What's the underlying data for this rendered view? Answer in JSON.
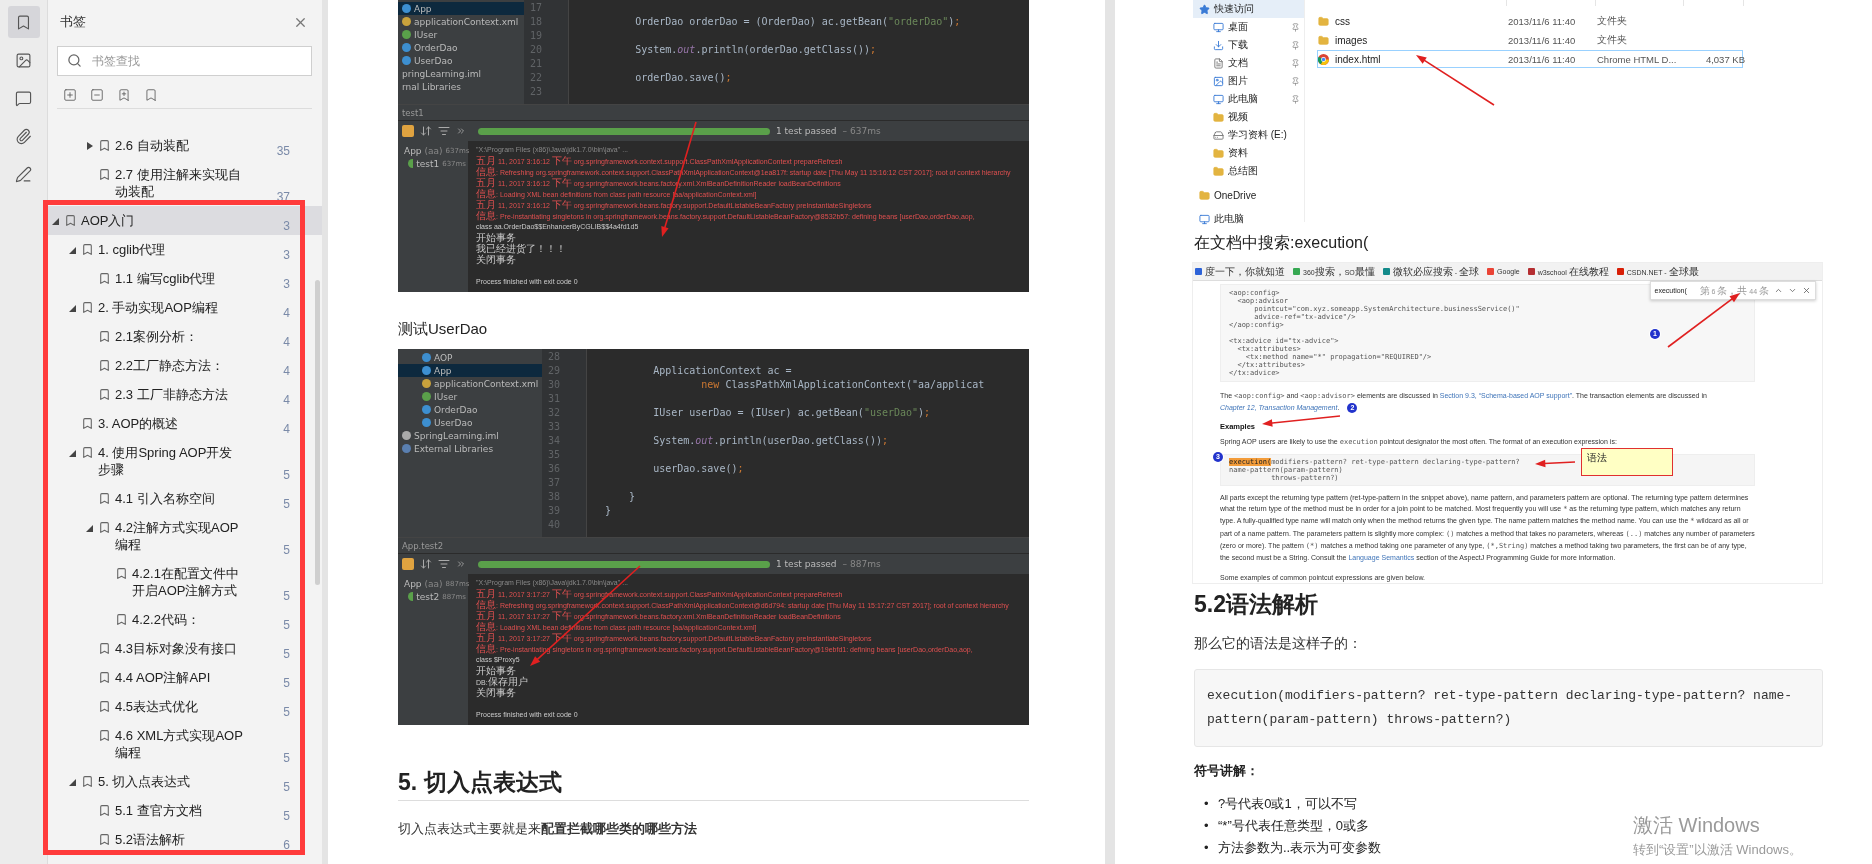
{
  "rail": [
    {
      "kind": "bookmarks",
      "selected": true
    },
    {
      "kind": "images",
      "selected": false
    },
    {
      "kind": "comments",
      "selected": false
    },
    {
      "kind": "attachments",
      "selected": false
    },
    {
      "kind": "signature",
      "selected": false
    }
  ],
  "sidebar": {
    "title": "书签",
    "search": {
      "placeholder": "书签查找"
    },
    "bookmarks": [
      {
        "children": [
          {
            "children": [
              {
                "label": "2.6 自动装配",
                "page": "35",
                "expanded": false,
                "selected": false
              },
              {
                "label": "2.7  使用注解来实现自动装配",
                "page": "37",
                "selected": false
              }
            ]
          }
        ]
      },
      {
        "label": "AOP入门",
        "page": "3",
        "expanded": true,
        "selected": true,
        "children": [
          {
            "label": "1. cglib代理",
            "page": "3",
            "expanded": true,
            "selected": false,
            "children": [
              {
                "label": "1.1 编写cglib代理",
                "page": "3",
                "selected": false
              }
            ]
          },
          {
            "label": "2. 手动实现AOP编程",
            "page": "4",
            "expanded": true,
            "selected": false,
            "children": [
              {
                "label": "2.1案例分析：",
                "page": "4",
                "selected": false
              },
              {
                "label": "2.2工厂静态方法：",
                "page": "4",
                "selected": false
              },
              {
                "label": "2.3 工厂非静态方法",
                "page": "4",
                "selected": false
              }
            ]
          },
          {
            "label": "3. AOP的概述",
            "page": "4",
            "selected": false
          },
          {
            "label": "4. 使用Spring AOP开发步骤",
            "page": "5",
            "expanded": true,
            "selected": false,
            "children": [
              {
                "label": "4.1 引入名称空间",
                "page": "5",
                "selected": false
              },
              {
                "label": "4.2注解方式实现AOP编程",
                "page": "5",
                "expanded": true,
                "selected": false,
                "children": [
                  {
                    "label": "4.2.1在配置文件中开启AOP注解方式",
                    "page": "5",
                    "selected": false
                  },
                  {
                    "label": "4.2.2代码：",
                    "page": "5",
                    "selected": false
                  }
                ]
              },
              {
                "label": "4.3目标对象没有接口",
                "page": "5",
                "selected": false
              },
              {
                "label": "4.4 AOP注解API",
                "page": "5",
                "selected": false
              },
              {
                "label": "4.5表达式优化",
                "page": "5",
                "selected": false
              },
              {
                "label": "4.6 XML方式实现AOP编程",
                "page": "5",
                "selected": false
              }
            ]
          },
          {
            "label": "5. 切入点表达式",
            "page": "5",
            "expanded": true,
            "selected": false,
            "children": [
              {
                "label": "5.1 查官方文档",
                "page": "5",
                "selected": false
              },
              {
                "label": "5.2语法解析",
                "page": "6",
                "selected": false
              }
            ]
          }
        ]
      }
    ]
  },
  "left_page": [
    {
      "kind": "ide",
      "cut_left": true,
      "tree": [
        {
          "children": [
            {
              "label": "App",
              "kind": "class",
              "selected": true
            },
            {
              "label": "applicationContext.xml",
              "kind": "xml",
              "selected": false
            },
            {
              "label": "IUser",
              "kind": "interface",
              "selected": false
            },
            {
              "label": "OrderDao",
              "kind": "class",
              "selected": false
            },
            {
              "label": "UserDao",
              "kind": "class",
              "selected": false
            }
          ]
        },
        {
          "label": "pringLearning.iml",
          "selected": false
        },
        {
          "label": "rnal Libraries",
          "selected": false
        }
      ],
      "code": [
        {
          "num": "17"
        },
        {
          "num": "18",
          "text": "        OrderDao orderDao = (OrderDao) ac.getBean(\"orderDao\");"
        },
        {
          "num": "19"
        },
        {
          "num": "20",
          "text": "        System.out.println(orderDao.getClass());"
        },
        {
          "num": "21"
        },
        {
          "num": "22",
          "text": "        orderDao.save();"
        },
        {
          "num": "23"
        }
      ],
      "run_tab": "test1",
      "status": "1 test passed",
      "duration": "– 637ms",
      "level": 1,
      "tests": [
        {
          "label": "App",
          "detail": "(aa)",
          "time": "637ms",
          "kind": "suite"
        },
        {
          "label": "test1",
          "time": "637ms",
          "kind": "test"
        }
      ],
      "console": [
        {
          "kind": "cmd",
          "text": "\"X:\\Program Files (x86)\\Java\\jdk1.7.0\\bin\\java\" ..."
        },
        {
          "kind": "log",
          "text": "五月 11, 2017 3:16:12 下午 org.springframework.context.support.ClassPathXmlApplicationContext prepareRefresh"
        },
        {
          "kind": "log",
          "text": "信息: Refreshing org.springframework.context.support.ClassPathXmlApplicationContext@1ea817f: startup date [Thu May 11 15:16:12 CST 2017]; root of context hierarchy"
        },
        {
          "kind": "log",
          "text": "五月 11, 2017 3:16:12 下午 org.springframework.beans.factory.xml.XmlBeanDefinitionReader loadBeanDefinitions"
        },
        {
          "kind": "log",
          "text": "信息: Loading XML bean definitions from class path resource [aa/applicationContext.xml]"
        },
        {
          "kind": "log",
          "text": "五月 11, 2017 3:16:12 下午 org.springframework.beans.factory.support.DefaultListableBeanFactory preInstantiateSingletons"
        },
        {
          "kind": "log",
          "text": "信息: Pre-instantiating singletons in org.springframework.beans.factory.support.DefaultListableBeanFactory@8532b57: defining beans [userDao,orderDao,aop,"
        },
        {
          "kind": "out",
          "text": "class aa.OrderDao$$EnhancerByCGLIB$$4a4fd1d5"
        },
        {
          "kind": "out",
          "text": "开始事务"
        },
        {
          "kind": "out",
          "text": "我已经进货了！！！"
        },
        {
          "kind": "out",
          "text": "关闭事务"
        },
        {
          "kind": "exit",
          "text": "Process finished with exit code 0"
        }
      ]
    },
    {
      "kind": "caption",
      "text": "测试UserDao"
    },
    {
      "kind": "ide",
      "cut_left": false,
      "tree": [
        {
          "children": [
            {
              "label": "AOP",
              "kind": "class",
              "selected": false
            },
            {
              "label": "App",
              "kind": "class",
              "selected": true
            },
            {
              "label": "applicationContext.xml",
              "kind": "xml",
              "selected": false
            },
            {
              "label": "IUser",
              "kind": "interface",
              "selected": false
            },
            {
              "label": "OrderDao",
              "kind": "class",
              "selected": false
            },
            {
              "label": "UserDao",
              "kind": "class",
              "selected": false
            }
          ]
        },
        {
          "label": "SpringLearning.iml",
          "kind": "file",
          "selected": false
        },
        {
          "label": "External Libraries",
          "kind": "library",
          "selected": false
        }
      ],
      "code": [
        {
          "num": "28"
        },
        {
          "num": "29",
          "text": "        ApplicationContext ac ="
        },
        {
          "num": "30",
          "text": "                new ClassPathXmlApplicationContext(\"aa/applicat"
        },
        {
          "num": "31"
        },
        {
          "num": "32",
          "text": "        IUser userDao = (IUser) ac.getBean(\"userDao\");"
        },
        {
          "num": "33"
        },
        {
          "num": "34",
          "text": "        System.out.println(userDao.getClass());"
        },
        {
          "num": "35"
        },
        {
          "num": "36",
          "text": "        userDao.save();"
        },
        {
          "num": "37"
        },
        {
          "num": "38",
          "text": "    }"
        },
        {
          "num": "39",
          "text": "}"
        },
        {
          "num": "40"
        }
      ],
      "run_tab": "App.test2",
      "status": "1 test passed",
      "duration": "– 887ms",
      "level": 1,
      "tests": [
        {
          "label": "App",
          "detail": "(aa)",
          "time": "887ms",
          "kind": "suite"
        },
        {
          "label": "test2",
          "time": "887ms",
          "kind": "test"
        }
      ],
      "console": [
        {
          "kind": "cmd",
          "text": "\"X:\\Program Files (x86)\\Java\\jdk1.7.0\\bin\\java\" ..."
        },
        {
          "kind": "log",
          "text": "五月 11, 2017 3:17:27 下午 org.springframework.context.support.ClassPathXmlApplicationContext prepareRefresh"
        },
        {
          "kind": "log",
          "text": "信息: Refreshing org.springframework.context.support.ClassPathXmlApplicationContext@d6d794: startup date [Thu May 11 15:17:27 CST 2017]; root of context hierarchy"
        },
        {
          "kind": "log",
          "text": "五月 11, 2017 3:17:27 下午 org.springframework.beans.factory.xml.XmlBeanDefinitionReader loadBeanDefinitions"
        },
        {
          "kind": "log",
          "text": "信息: Loading XML bean definitions from class path resource [aa/applicationContext.xml]"
        },
        {
          "kind": "log",
          "text": "五月 11, 2017 3:17:27 下午 org.springframework.beans.factory.support.DefaultListableBeanFactory preInstantiateSingletons"
        },
        {
          "kind": "log",
          "text": "信息: Pre-instantiating singletons in org.springframework.beans.factory.support.DefaultListableBeanFactory@19ebfd1: defining beans [userDao,orderDao,aop,"
        },
        {
          "kind": "out",
          "text": "class $Proxy5"
        },
        {
          "kind": "out",
          "text": "开始事务"
        },
        {
          "kind": "out",
          "text": "DB:保存用户"
        },
        {
          "kind": "out",
          "text": "关闭事务"
        },
        {
          "kind": "exit",
          "text": "Process finished with exit code 0"
        }
      ]
    },
    {
      "kind": "heading",
      "text": "5. 切入点表达式"
    },
    {
      "kind": "text",
      "text": "切入点表达式主要就是来**配置拦截哪些类的哪些方法**"
    }
  ],
  "right_page": [
    {
      "kind": "explorer",
      "nav": [
        {
          "label": "快速访问",
          "kind": "star",
          "selected": true,
          "children": [
            {
              "label": "桌面",
              "kind": "desktop",
              "pinned": true,
              "selected": false
            },
            {
              "label": "下载",
              "kind": "download",
              "pinned": true,
              "selected": false
            },
            {
              "label": "文档",
              "kind": "document",
              "pinned": true,
              "selected": false
            },
            {
              "label": "图片",
              "kind": "pictures",
              "pinned": true,
              "selected": false
            },
            {
              "label": "此电脑",
              "kind": "pc",
              "pinned": true,
              "selected": false
            },
            {
              "label": "视频",
              "kind": "folder",
              "pinned": false,
              "selected": false
            },
            {
              "label": "学习资料 (E:)",
              "kind": "drive",
              "pinned": false,
              "selected": false
            },
            {
              "label": "资料",
              "kind": "folder",
              "pinned": false,
              "selected": false
            },
            {
              "label": "总结图",
              "kind": "folder",
              "pinned": false,
              "selected": false
            }
          ]
        },
        {
          "label": "OneDrive",
          "kind": "folder",
          "selected": false
        },
        {
          "label": "此电脑",
          "kind": "pc",
          "selected": false
        }
      ],
      "files": [
        {
          "name": "css",
          "date": "2013/11/6 11:40",
          "type": "文件夹",
          "kind": "folder",
          "selected": false
        },
        {
          "name": "images",
          "date": "2013/11/6 11:40",
          "type": "文件夹",
          "kind": "folder",
          "selected": false
        },
        {
          "name": "index.html",
          "date": "2013/11/6 11:40",
          "type": "Chrome HTML D...",
          "size": "4,037 KB",
          "kind": "html",
          "selected": true
        }
      ]
    },
    {
      "kind": "caption",
      "text": "在文档中搜索:execution("
    },
    {
      "kind": "browser",
      "bookmarks": [
        {
          "label": "度一下，你就知道",
          "color": "#2d63d8"
        },
        {
          "label": "360搜索，SO最懂",
          "color": "#36a852"
        },
        {
          "label": "微软必应搜索 - 全球",
          "color": "#138a8a"
        },
        {
          "label": "Google",
          "color": "#ea4335"
        },
        {
          "label": "w3school 在线教程",
          "color": "#b52e31"
        },
        {
          "label": "CSDN.NET - 全球最",
          "color": "#d81e06"
        }
      ],
      "find": {
        "value": "execution(",
        "count": "第 6 条，共 44 条"
      },
      "code": [
        [
          "<aop:config>",
          "  <aop:advisor",
          "      pointcut=\"com.xyz.someapp.SystemArchitecture.businessService()\"",
          "      advice-ref=\"tx-advice\"/>",
          "</aop:config>"
        ],
        [
          "<tx:advice id=\"tx-advice\">",
          "  <tx:attributes>",
          "    <tx:method name=\"*\" propagation=\"REQUIRED\"/>",
          "  </tx:attributes>",
          "</tx:advice>"
        ]
      ],
      "para1": [
        {
          "text": "The "
        },
        {
          "text": "<aop:config>",
          "kind": "code"
        },
        {
          "text": " and "
        },
        {
          "text": "<aop:advisor>",
          "kind": "code"
        },
        {
          "text": " elements are discussed in "
        },
        {
          "text": "Section 9.3, “Schema-based AOP support”",
          "kind": "link"
        },
        {
          "text": ". The transaction elements are discussed in "
        },
        {
          "text": "Chapter 12, Transaction Management",
          "kind": "link_italic"
        },
        {
          "text": "."
        }
      ],
      "subheading": "Examples",
      "para2": [
        {
          "text": "Spring AOP users are likely to use the "
        },
        {
          "text": "execution",
          "kind": "code"
        },
        {
          "text": " pointcut designator the most often. The format of an execution expression is:"
        }
      ],
      "syntax": {
        "highlight": "execution(",
        "rest": "modifiers-pattern? ret-type-pattern declaring-type-pattern? name-pattern(param-pattern)",
        "line2": "throws-pattern?)"
      },
      "para3": [
        {
          "text": "All parts except the returning type pattern (ret-type-pattern in the snippet above), name pattern, and parameters pattern are optional. The returning type pattern determines what the return type of the method must be in order for a join point to be matched. Most frequently you will use "
        },
        {
          "text": "*",
          "kind": "code"
        },
        {
          "text": " as the returning type pattern, which matches any return type. A fully-qualified type name will match only when the method returns the given type. The name pattern matches the method name. You can use the "
        },
        {
          "text": "*",
          "kind": "code"
        },
        {
          "text": " wildcard as all or part of a name pattern. The parameters pattern is slightly more complex: "
        },
        {
          "text": "()",
          "kind": "code"
        },
        {
          "text": " matches a method that takes no parameters, whereas "
        },
        {
          "text": "(..)",
          "kind": "code"
        },
        {
          "text": " matches any number of parameters (zero or more). The pattern "
        },
        {
          "text": "(*)",
          "kind": "code"
        },
        {
          "text": " matches a method taking one parameter of any type, "
        },
        {
          "text": "(*,String)",
          "kind": "code"
        },
        {
          "text": " matches a method taking two parameters, the first can be of any type, the second must be a String. Consult the "
        },
        {
          "text": "Language Semantics",
          "kind": "link"
        },
        {
          "text": " section of the AspectJ Programming Guide for more information."
        }
      ],
      "para4": [
        {
          "text": "Some examples of common pointcut expressions are given below."
        }
      ],
      "markers": [
        "1",
        "2",
        "3"
      ],
      "note": "语法"
    },
    {
      "kind": "heading",
      "text": "5.2语法解析"
    },
    {
      "kind": "text",
      "text": "那么它的语法是这样子的："
    },
    {
      "kind": "code",
      "text": "execution(modifiers-pattern? ret-type-pattern declaring-type-pattern? name-pattern(param-pattern) throws-pattern?)"
    },
    {
      "kind": "subheading",
      "text": "符号讲解："
    },
    {
      "kind": "bullets",
      "marker": "•",
      "items": [
        "?号代表0或1，可以不写",
        "“*”号代表任意类型，0或多",
        "方法参数为..表示为可变参数"
      ]
    }
  ],
  "os_overlay": {
    "title": "激活 Windows",
    "subtitle": "转到“设置”以激活 Windows。"
  }
}
